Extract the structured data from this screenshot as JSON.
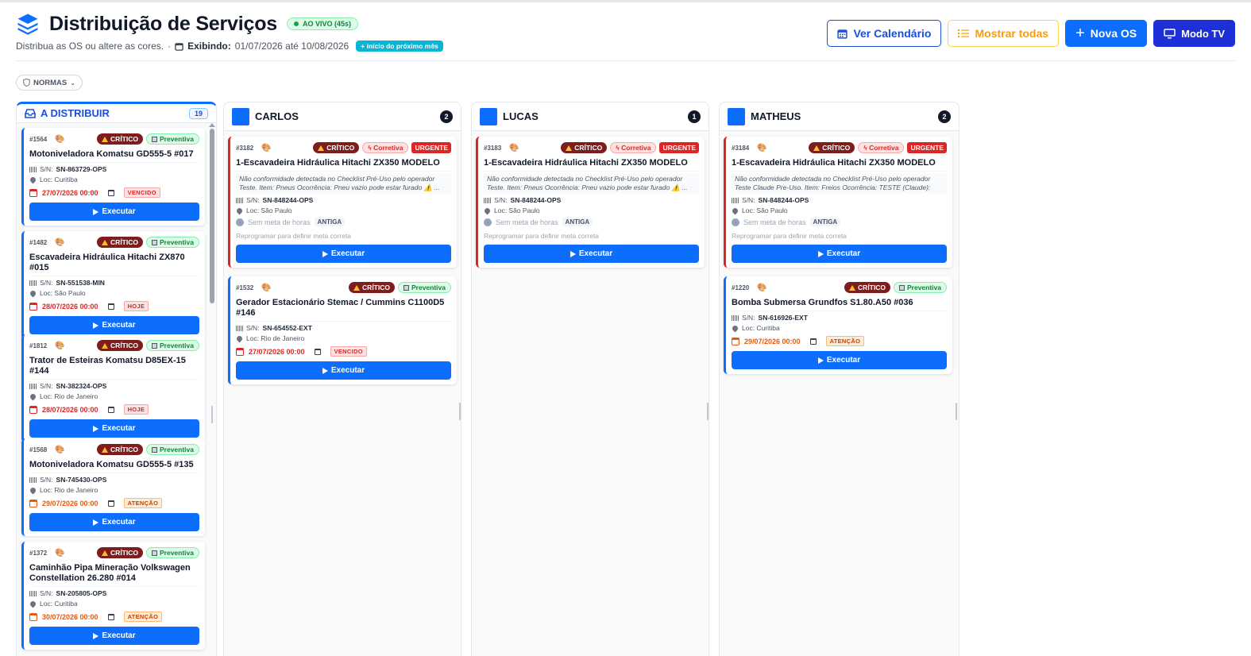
{
  "header": {
    "title": "Distribuição de Serviços",
    "live_badge": "AO VIVO (45s)",
    "subtitle": "Distribua as OS ou altere as cores.",
    "showing_label": "Exibindo:",
    "showing_range": "01/07/2026 até 10/08/2026",
    "next_month_badge": "+ início do próximo mês"
  },
  "actions": {
    "calendar": "Ver Calendário",
    "show_all": "Mostrar todas",
    "new_os": "Nova OS",
    "tv_mode": "Modo TV"
  },
  "filter": {
    "normas": "NORMAS"
  },
  "colors": {
    "primary": "#0d6efd",
    "critical": "#7f1d1d",
    "urgent": "#dc2626",
    "preventive": "#15803d"
  },
  "distribute": {
    "title": "A DISTRIBUIR",
    "count": "19",
    "cards": [
      {
        "os": "#1564",
        "crit": "CRÍTICO",
        "type": "Preventiva",
        "title": "Motoniveladora Komatsu GD555-5 #017",
        "sn_label": "S/N:",
        "sn": "SN-863729-OPS",
        "loc": "Loc: Curitiba",
        "date": "27/07/2026 00:00",
        "tag": "VENCIDO",
        "exec": "Executar"
      },
      {
        "os": "#1482",
        "crit": "CRÍTICO",
        "type": "Preventiva",
        "title": "Escavadeira Hidráulica Hitachi ZX870 #015",
        "sn_label": "S/N:",
        "sn": "SN-551538-MIN",
        "loc": "Loc: São Paulo",
        "date": "28/07/2026 00:00",
        "tag": "HOJE",
        "exec": "Executar"
      },
      {
        "os": "#1812",
        "crit": "CRÍTICO",
        "type": "Preventiva",
        "title": "Trator de Esteiras Komatsu D85EX-15 #144",
        "sn_label": "S/N:",
        "sn": "SN-382324-OPS",
        "loc": "Loc: Rio de Janeiro",
        "date": "28/07/2026 00:00",
        "tag": "HOJE",
        "exec": "Executar"
      },
      {
        "os": "#1568",
        "crit": "CRÍTICO",
        "type": "Preventiva",
        "title": "Motoniveladora Komatsu GD555-5 #135",
        "sn_label": "S/N:",
        "sn": "SN-745430-OPS",
        "loc": "Loc: Rio de Janeiro",
        "date": "29/07/2026 00:00",
        "tag": "ATENÇÃO",
        "exec": "Executar"
      },
      {
        "os": "#1372",
        "crit": "CRÍTICO",
        "type": "Preventiva",
        "title": "Caminhão Pipa Mineração Volkswagen Constellation 26.280 #014",
        "sn_label": "S/N:",
        "sn": "SN-205805-OPS",
        "loc": "Loc: Curitiba",
        "date": "30/07/2026 00:00",
        "tag": "ATENÇÃO",
        "exec": "Executar"
      }
    ]
  },
  "technicians": [
    {
      "name": "CARLOS",
      "count": "2",
      "cards": [
        {
          "os": "#3182",
          "crit": "CRÍTICO",
          "type": "Corretiva",
          "urgent": "URGENTE",
          "title": "1-Escavadeira Hidráulica Hitachi ZX350 MODELO",
          "desc": "Não conformidade detectada no Checklist Pré-Uso pelo operador Teste. Item: Pneus Ocorrência: Pneu vazio pode estar furado ⚠️ ...",
          "sn_label": "S/N:",
          "sn": "SN-848244-OPS",
          "loc": "Loc: São Paulo",
          "meta": "Sem meta de horas",
          "antiga": "ANTIGA",
          "repro": "Reprogramar para definir meta correta",
          "exec": "Executar"
        },
        {
          "os": "#1532",
          "crit": "CRÍTICO",
          "type": "Preventiva",
          "title": "Gerador Estacionário Stemac / Cummins C1100D5 #146",
          "sn_label": "S/N:",
          "sn": "SN-654552-EXT",
          "loc": "Loc: Rio de Janeiro",
          "date": "27/07/2026 00:00",
          "tag": "VENCIDO",
          "exec": "Executar"
        }
      ]
    },
    {
      "name": "LUCAS",
      "count": "1",
      "cards": [
        {
          "os": "#3183",
          "crit": "CRÍTICO",
          "type": "Corretiva",
          "urgent": "URGENTE",
          "title": "1-Escavadeira Hidráulica Hitachi ZX350 MODELO",
          "desc": "Não conformidade detectada no Checklist Pré-Uso pelo operador Teste. Item: Pneus Ocorrência: Pneu vazio pode estar furado ⚠️ ...",
          "sn_label": "S/N:",
          "sn": "SN-848244-OPS",
          "loc": "Loc: São Paulo",
          "meta": "Sem meta de horas",
          "antiga": "ANTIGA",
          "repro": "Reprogramar para definir meta correta",
          "exec": "Executar"
        }
      ]
    },
    {
      "name": "MATHEUS",
      "count": "2",
      "cards": [
        {
          "os": "#3184",
          "crit": "CRÍTICO",
          "type": "Corretiva",
          "urgent": "URGENTE",
          "title": "1-Escavadeira Hidráulica Hitachi ZX350 MODELO",
          "desc": "Não conformidade detectada no Checklist Pré-Uso pelo operador Teste Claude Pre-Uso. Item: Freios Ocorrência: TESTE (Claude): freio...",
          "sn_label": "S/N:",
          "sn": "SN-848244-OPS",
          "loc": "Loc: São Paulo",
          "meta": "Sem meta de horas",
          "antiga": "ANTIGA",
          "repro": "Reprogramar para definir meta correta",
          "exec": "Executar"
        },
        {
          "os": "#1220",
          "crit": "CRÍTICO",
          "type": "Preventiva",
          "title": "Bomba Submersa Grundfos S1.80.A50 #036",
          "sn_label": "S/N:",
          "sn": "SN-616926-EXT",
          "loc": "Loc: Curitiba",
          "date": "29/07/2026 00:00",
          "tag": "ATENÇÃO",
          "exec": "Executar"
        }
      ]
    }
  ]
}
